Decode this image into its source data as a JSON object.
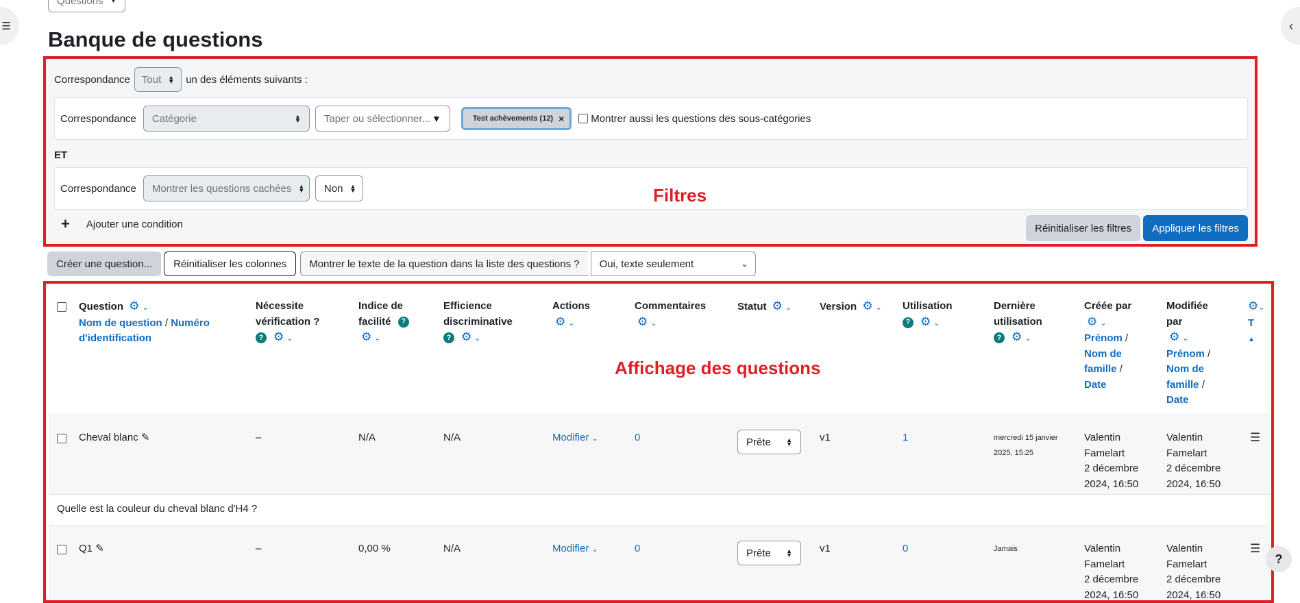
{
  "top_select": {
    "value": "Questions"
  },
  "page_title": "Banque de questions",
  "filters": {
    "match_label": "Correspondance",
    "match_value": "Tout",
    "match_suffix": "un des éléments suivants :",
    "condition1": {
      "label": "Correspondance",
      "type": "Catégorie",
      "search_placeholder": "Taper ou sélectionner...",
      "chip": "Test achèvements (12)",
      "chip_remove": "×",
      "subcat_label": "Montrer aussi les questions des sous-catégories"
    },
    "joiner": "ET",
    "condition2": {
      "label": "Correspondance",
      "type": "Montrer les questions cachées",
      "value": "Non"
    },
    "add_condition": "Ajouter une condition",
    "reset_label": "Réinitialiser les filtres",
    "apply_label": "Appliquer les filtres",
    "annotation": "Filtres"
  },
  "toolbar": {
    "create_label": "Créer une question...",
    "reset_columns_label": "Réinitialiser les colonnes",
    "show_text_label": "Montrer le texte de la question dans la liste des questions ?",
    "show_text_value": "Oui, texte seulement"
  },
  "table": {
    "annotation": "Affichage des questions",
    "headers": {
      "question": "Question",
      "question_sub1": "Nom de question",
      "question_sep": "/",
      "question_sub2": "Numéro d'identification",
      "verification_1": "Nécessite",
      "verification_2": "vérification ?",
      "facility_1": "Indice de",
      "facility_2": "facilité",
      "discrimination_1": "Efficience",
      "discrimination_2": "discriminative",
      "actions": "Actions",
      "comments": "Commentaires",
      "status": "Statut",
      "version": "Version",
      "usage": "Utilisation",
      "last_used_1": "Dernière",
      "last_used_2": "utilisation",
      "created_1": "Créée par",
      "created_first": "Prénom",
      "created_last_1": "Nom de",
      "created_last_2": "famille",
      "created_date": "Date",
      "modified_1": "Modifiée",
      "modified_2": "par",
      "modified_first": "Prénom",
      "modified_last_1": "Nom de",
      "modified_last_2": "famille",
      "modified_date": "Date",
      "last_col": "T",
      "sep": "/"
    },
    "rows": [
      {
        "name": "Cheval blanc",
        "verification": "–",
        "facility": "N/A",
        "discrimination": "N/A",
        "action": "Modifier",
        "comments": "0",
        "status": "Prête",
        "version": "v1",
        "usage": "1",
        "last_used_1": "mercredi 15 janvier",
        "last_used_2": "2025, 15:25",
        "created_first": "Valentin",
        "created_last": "Famelart",
        "created_date_1": "2 décembre",
        "created_date_2": "2024, 16:50",
        "modified_first": "Valentin",
        "modified_last": "Famelart",
        "modified_date_1": "2 décembre",
        "modified_date_2": "2024, 16:50",
        "question_text": "Quelle est la couleur du cheval blanc d'H4 ?"
      },
      {
        "name": "Q1",
        "verification": "–",
        "facility": "0,00 %",
        "discrimination": "N/A",
        "action": "Modifier",
        "comments": "0",
        "status": "Prête",
        "version": "v1",
        "usage": "0",
        "last_used_1": "Jamais",
        "created_first": "Valentin",
        "created_last": "Famelart",
        "created_date_1": "2 décembre",
        "created_date_2": "2024, 16:50",
        "modified_first": "Valentin",
        "modified_last": "Famelart",
        "modified_date_1": "2 décembre",
        "modified_date_2": "2024, 16:50"
      }
    ]
  },
  "help_button": "?",
  "colors": {
    "accent": "#0f6cbf",
    "annotation": "#e01e26",
    "help_badge": "#0b7a7d"
  }
}
